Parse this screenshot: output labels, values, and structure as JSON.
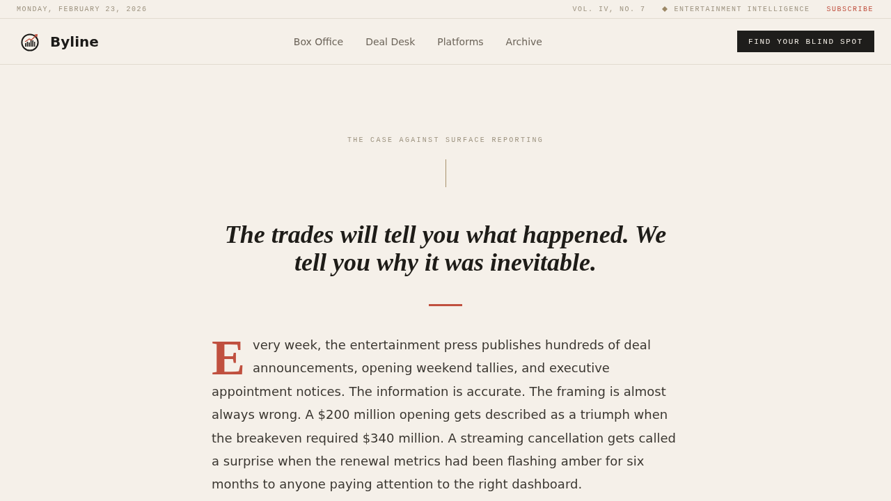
{
  "top_bar": {
    "date": "MONDAY, FEBRUARY 23, 2026",
    "issue": "VOL. IV, NO. 7",
    "section": "ENTERTAINMENT INTELLIGENCE",
    "subscribe": "SUBSCRIBE"
  },
  "header": {
    "brand": "Byline",
    "nav": [
      "Box Office",
      "Deal Desk",
      "Platforms",
      "Archive"
    ],
    "cta": "FIND YOUR BLIND SPOT"
  },
  "hero": {
    "eyebrow": "THE CASE AGAINST SURFACE REPORTING",
    "headline": "The trades will tell you what happened. We tell you why it was inevitable.",
    "lead": "Every week, the entertainment press publishes hundreds of deal announcements, opening weekend tallies, and executive appointment notices. The information is accurate. The framing is almost always wrong. A $200 million opening gets described as a triumph when the breakeven required $340 million. A streaming cancellation gets called a surprise when the renewal metrics had been flashing amber for six months to anyone paying attention to the right dashboard."
  }
}
